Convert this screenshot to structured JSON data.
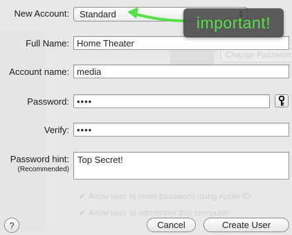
{
  "form": {
    "new_account": {
      "label": "New Account:",
      "value": "Standard"
    },
    "full_name": {
      "label": "Full Name:",
      "value": "Home Theater"
    },
    "account_name": {
      "label": "Account name:",
      "value": "media"
    },
    "password": {
      "label": "Password:",
      "value": "••••"
    },
    "verify": {
      "label": "Verify:",
      "value": "••••"
    },
    "password_hint": {
      "label": "Password hint:",
      "sublabel": "(Recommended)",
      "value": "Top Secret!"
    }
  },
  "buttons": {
    "help": "?",
    "cancel": "Cancel",
    "create": "Create User"
  },
  "annotation": {
    "text": "important!",
    "text_color": "#58e04a",
    "arrow_color": "#58e04a"
  },
  "background_window": {
    "change_password": "Change Password",
    "option_1": "Allow user to reset password using Apple ID",
    "option_2": "Allow user to administer this computer"
  },
  "icons": {
    "key": "key-icon",
    "popup_arrows": "up-down-arrows-icon"
  }
}
